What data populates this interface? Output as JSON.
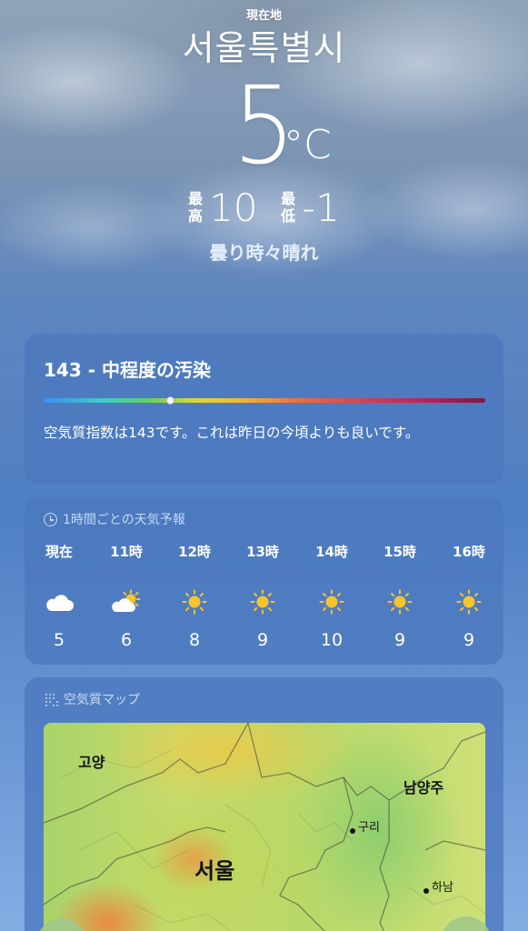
{
  "header": {
    "location_label": "現在地",
    "city": "서울특별시",
    "temperature": "5",
    "unit": "°C",
    "high_label": "最高",
    "high_value": "10",
    "low_label": "最低",
    "low_value": "-1",
    "condition": "曇り時々晴れ"
  },
  "aqi": {
    "title": "143 - 中程度の汚染",
    "level_fraction": 0.288,
    "description": "空気質指数は143です。これは昨日の今頃よりも良いです。"
  },
  "forecast": {
    "header_icon": "clock-icon",
    "header": "1時間ごとの天気予報",
    "hours": [
      {
        "time": "現在",
        "icon": "cloud-icon",
        "temp": "5"
      },
      {
        "time": "11時",
        "icon": "partly-sunny-icon",
        "temp": "6"
      },
      {
        "time": "12時",
        "icon": "sun-icon",
        "temp": "8"
      },
      {
        "time": "13時",
        "icon": "sun-icon",
        "temp": "9"
      },
      {
        "time": "14時",
        "icon": "sun-icon",
        "temp": "10"
      },
      {
        "time": "15時",
        "icon": "sun-icon",
        "temp": "9"
      },
      {
        "time": "16時",
        "icon": "sun-icon",
        "temp": "9"
      }
    ]
  },
  "air_map": {
    "header_icon": "air-quality-icon",
    "header": "空気質マップ",
    "labels": {
      "goyang": "고양",
      "namyangju": "남양주",
      "guri": "구리",
      "seoul": "서울",
      "hanam": "하남"
    }
  },
  "colors": {
    "card_bg": "#4c78be",
    "accent_text": "#e6eefb"
  }
}
